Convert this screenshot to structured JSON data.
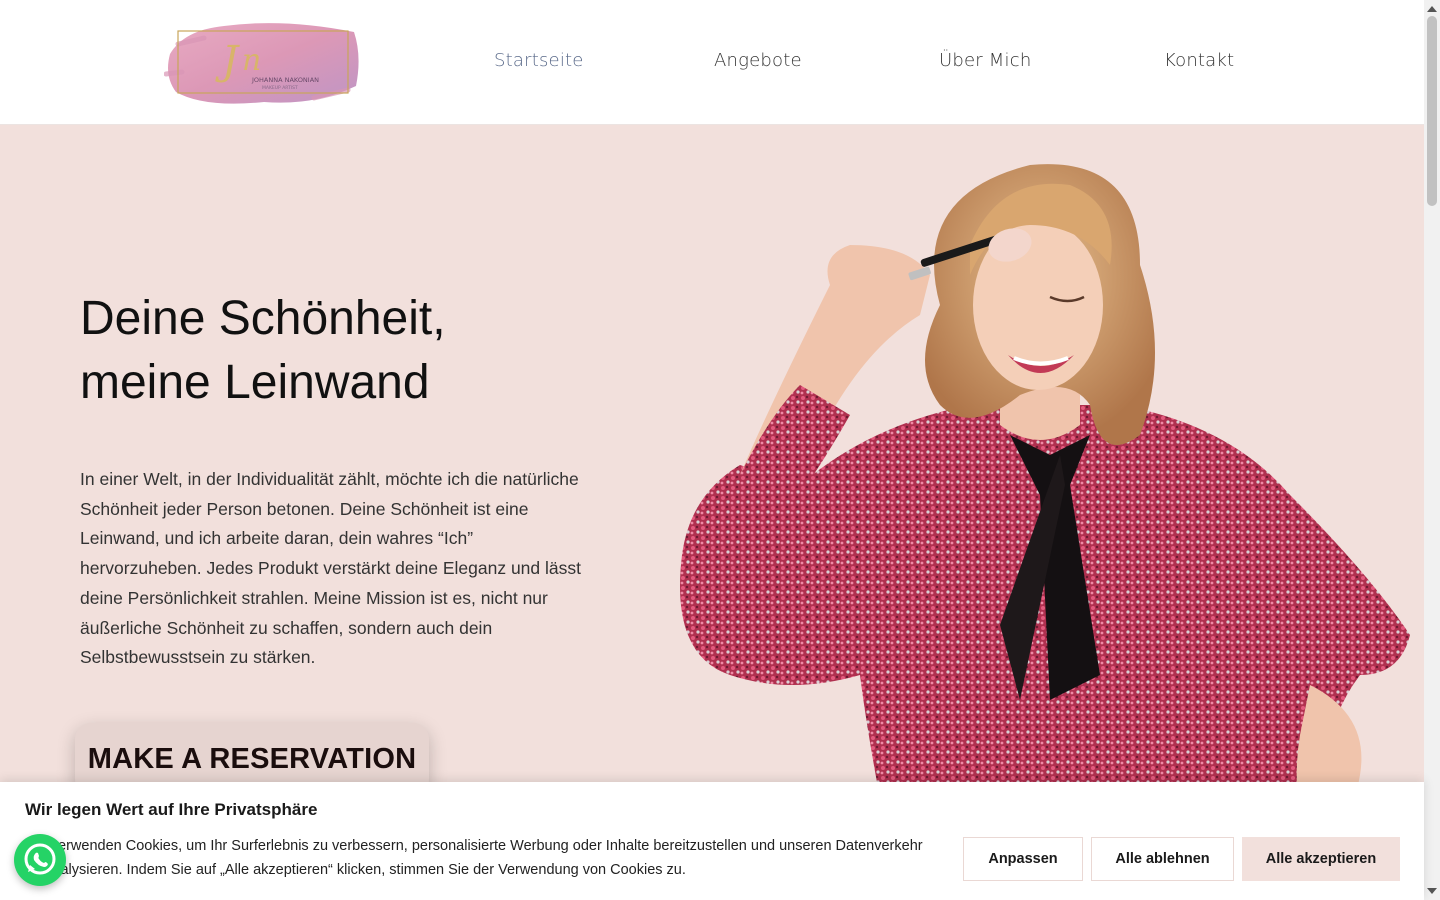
{
  "header": {
    "logo": {
      "monogram": "JN",
      "name": "JOHANNA NAKONIAN",
      "tagline": "MAKEUP ARTIST",
      "colors": {
        "brush_start": "#e49ab6",
        "brush_end": "#c98ab8",
        "frame": "#c9a55a"
      }
    },
    "nav": [
      {
        "label": "Startseite",
        "active": true
      },
      {
        "label": "Angebote",
        "active": false
      },
      {
        "label": "Über Mich",
        "active": false
      },
      {
        "label": "Kontakt",
        "active": false
      }
    ]
  },
  "hero": {
    "title_line1": "Deine Schönheit,",
    "title_line2": "meine Leinwand",
    "body": "In einer Welt, in der Individualität zählt, möchte ich die natürliche Schönheit jeder Person betonen. Deine Schönheit ist eine Leinwand, und ich arbeite daran, dein wahres “Ich” hervorzuheben. Jedes Produkt verstärkt deine Eleganz und lässt deine Persönlichkeit strahlen. Meine Mission ist es, nicht nur äußerliche Schönheit zu schaffen, sondern auch dein Selbstbewusstsein zu stärken.",
    "cta_label": "MAKE A RESERVATION",
    "background_color": "#f2e0dc"
  },
  "cookie_banner": {
    "title": "Wir legen Wert auf Ihre Privatsphäre",
    "text": "Wir verwenden Cookies, um Ihr Surferlebnis zu verbessern, personalisierte Werbung oder Inhalte bereitzustellen und unseren Datenverkehr zu analysieren. Indem Sie auf „Alle akzeptieren“ klicken, stimmen Sie der Verwendung von Cookies zu.",
    "buttons": {
      "customize": "Anpassen",
      "reject": "Alle ablehnen",
      "accept": "Alle akzeptieren"
    }
  },
  "floating": {
    "whatsapp_icon": "whatsapp-icon",
    "whatsapp_color": "#25d366"
  }
}
